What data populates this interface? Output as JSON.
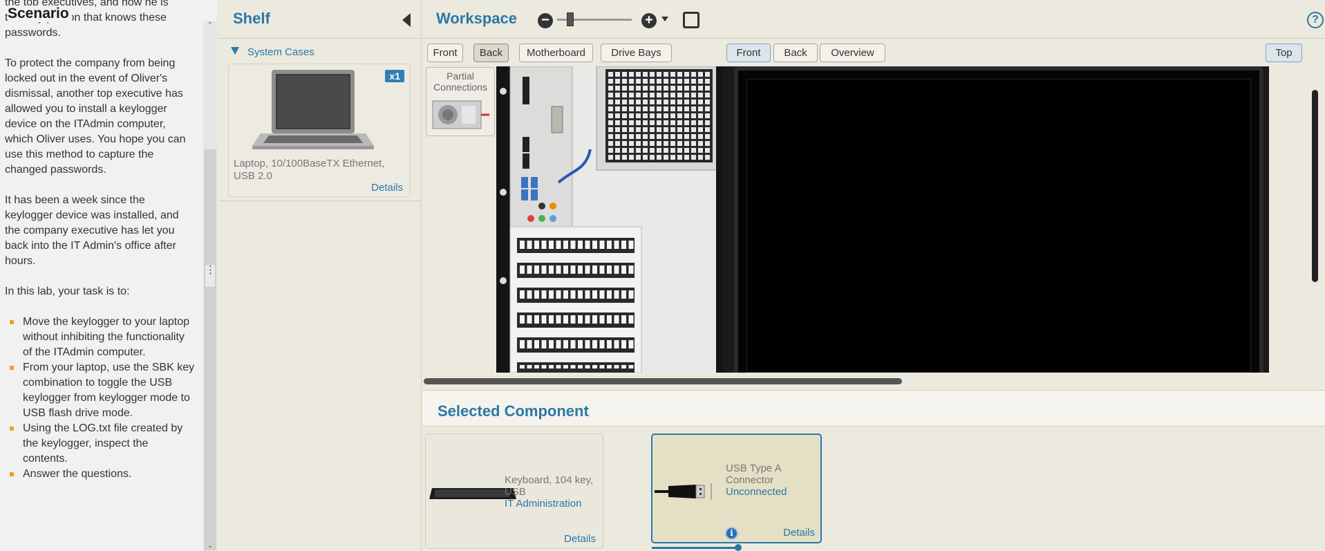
{
  "scenario": {
    "title": "Scenario",
    "partial_line": "the top executives, and how he is",
    "p1_rest": "the only person that knows these passwords.",
    "p2": "To protect the company from being locked out in the event of Oliver's dismissal, another top executive has allowed you to install a keylogger device on the ITAdmin computer, which Oliver uses. You hope you can use this method to capture the changed passwords.",
    "p3": "It has been a week since the keylogger device was installed, and the company executive has let you back into the IT Admin's office after hours.",
    "p4": "In this lab, your task is to:",
    "tasks": [
      "Move the keylogger to your laptop without inhibiting the functionality of the ITAdmin computer.",
      "From your laptop, use the SBK key combination to toggle the USB keylogger from keylogger mode to USB flash drive mode.",
      "Using the LOG.txt file created by the keylogger, inspect the contents.",
      "Answer the questions."
    ]
  },
  "shelf": {
    "title": "Shelf",
    "category": "System Cases",
    "items": [
      {
        "qty": "x1",
        "desc": "Laptop, 10/100BaseTX Ethernet, USB 2.0",
        "details": "Details"
      }
    ]
  },
  "workspace": {
    "title": "Workspace",
    "left_tabs": [
      "Front",
      "Back",
      "Motherboard",
      "Drive Bays"
    ],
    "left_active": "Back",
    "right_tabs": [
      "Front",
      "Back",
      "Overview"
    ],
    "right_active": "Front",
    "top_tab": "Top",
    "partial_connections": "Partial Connections",
    "help": "?"
  },
  "selected": {
    "title": "Selected Component",
    "components": [
      {
        "name": "Keyboard, 104 key, USB",
        "status": "IT Administration",
        "details": "Details"
      },
      {
        "name": "USB Type A Connector",
        "status": "Unconnected",
        "details": "Details"
      }
    ]
  },
  "colors": {
    "accent": "#2a78a6",
    "panel_bg": "#ece9df",
    "task_bullet": "#f0a020"
  },
  "icons": [
    "collapse-left-icon",
    "zoom-out-icon",
    "zoom-in-icon",
    "fullscreen-icon",
    "help-icon",
    "info-icon",
    "expand-triangle-icon"
  ]
}
